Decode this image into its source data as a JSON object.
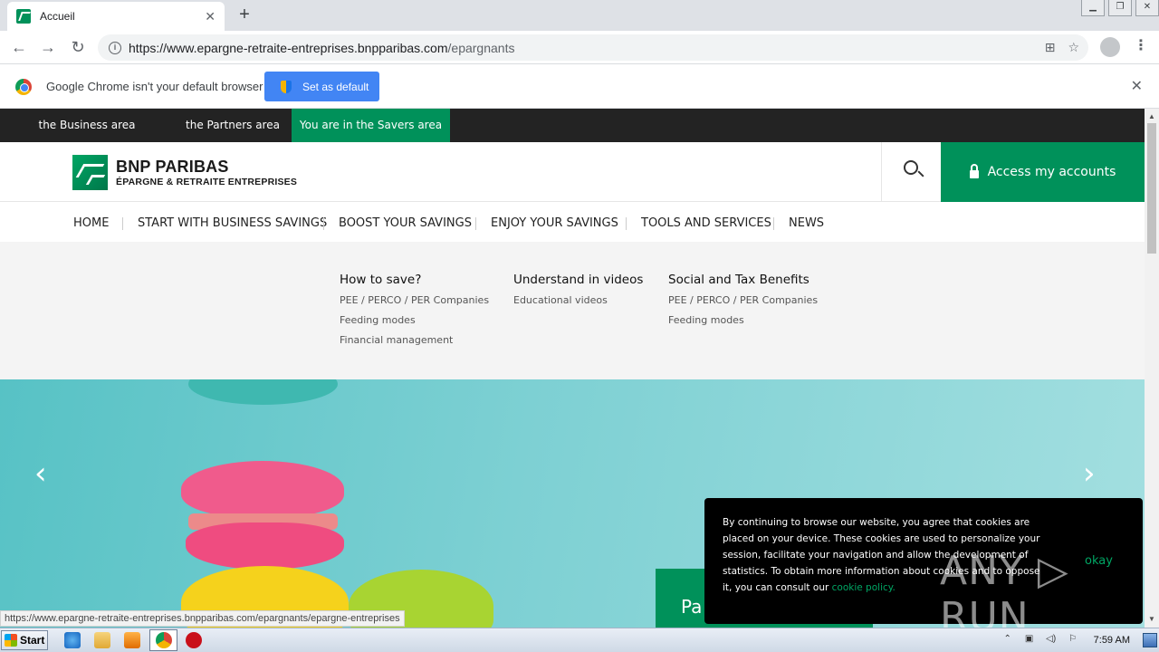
{
  "browser": {
    "tab_title": "Accueil",
    "new_tab": "+",
    "url_host": "https://www.epargne-retraite-entreprises.bnpparibas.com",
    "url_path": "/epargnants",
    "infobar_message": "Google Chrome isn't your default browser",
    "set_default_label": "Set as default",
    "status_url": "https://www.epargne-retraite-entreprises.bnpparibas.com/epargnants/epargne-entreprises"
  },
  "site": {
    "topbar": {
      "business": "the Business area",
      "partners": "the Partners area",
      "savers": "You are in the Savers area"
    },
    "logo": {
      "name": "BNP PARIBAS",
      "sub": "ÉPARGNE & RETRAITE ENTREPRISES"
    },
    "access_label": "Access my accounts",
    "nav": [
      "HOME",
      "START WITH BUSINESS SAVINGS",
      "BOOST YOUR SAVINGS",
      "ENJOY YOUR SAVINGS",
      "TOOLS AND SERVICES",
      "NEWS"
    ],
    "megamenu": {
      "col1": {
        "title": "How to save?",
        "links": [
          "PEE / PERCO / PER Companies",
          "Feeding modes",
          "Financial management"
        ]
      },
      "col2": {
        "title": "Understand in videos",
        "links": [
          "Educational videos"
        ]
      },
      "col3": {
        "title": "Social and Tax Benefits",
        "links": [
          "PEE / PERCO / PER Companies",
          "Feeding modes"
        ]
      }
    },
    "hero": {
      "prev": "‹",
      "next": "›",
      "promo_text": "Pa"
    },
    "cookie": {
      "text": "By continuing to browse our website, you agree that cookies are placed on your device. These cookies are used to personalize your session, facilitate your navigation and allow the development of statistics. To obtain more information about cookies and to oppose it, you can consult our",
      "link": "cookie policy.",
      "okay": "okay"
    }
  },
  "watermark": "ANY ▷ RUN",
  "taskbar": {
    "start": "Start",
    "clock": "7:59 AM"
  },
  "colors": {
    "brand_green": "#00915a",
    "topbar": "#232323",
    "chrome_blue": "#4285f4"
  }
}
